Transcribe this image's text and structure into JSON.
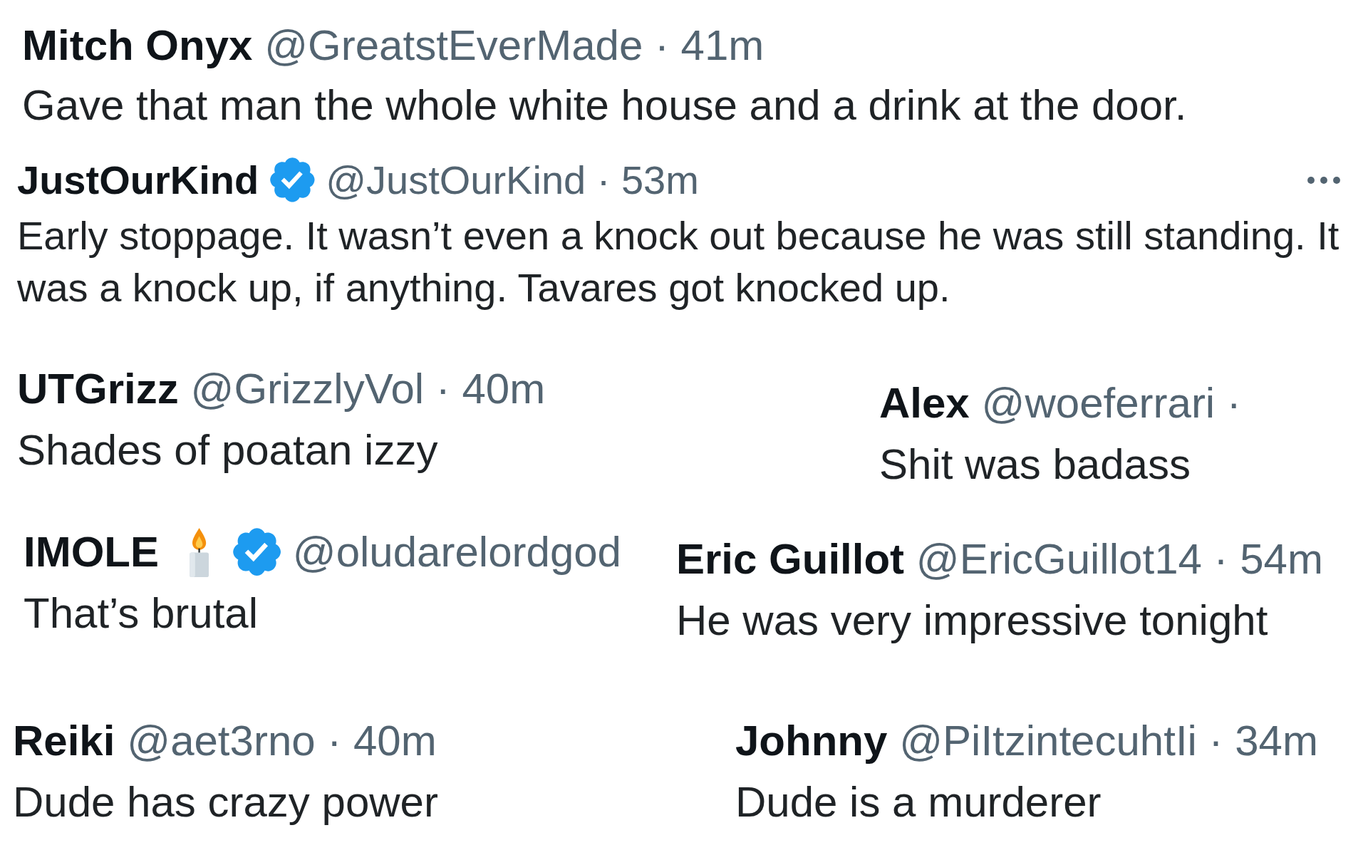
{
  "replies": [
    {
      "name": "Mitch Onyx",
      "meta": "@GreatstEverMade · 41m",
      "text": "Gave that man the whole white house and a drink at the door.",
      "more_menu": false
    },
    {
      "name": "JustOurKind",
      "badges": [
        {
          "kind": "verified"
        }
      ],
      "meta": "@JustOurKind · 53m",
      "text": "Early stoppage. It wasn’t even a knock out because he was still standing. It was a knock up, if anything. Tavares got knocked up.",
      "more_menu": true
    },
    {
      "name": "UTGrizz",
      "meta": "@GrizzlyVol · 40m",
      "text": "Shades of poatan izzy",
      "more_menu": false
    },
    {
      "name": "Alex",
      "meta": "@woeferrari ·",
      "text": "Shit was badass",
      "more_menu": false
    },
    {
      "name": "IMOLE",
      "badges": [
        {
          "kind": "candle"
        },
        {
          "kind": "verified"
        }
      ],
      "meta": "@oludarelordgod",
      "text": "That’s brutal",
      "more_menu": false
    },
    {
      "name": "Eric Guillot",
      "meta": "@EricGuillot14 · 54m",
      "text": "He was very impressive tonight",
      "more_menu": false
    },
    {
      "name": "Reiki",
      "meta": "@aet3rno · 40m",
      "text": "Dude has crazy power",
      "more_menu": false
    },
    {
      "name": "Johnny",
      "meta": "@PiItzintecuhtIi · 34m",
      "text": "Dude is a murderer",
      "more_menu": false
    }
  ]
}
